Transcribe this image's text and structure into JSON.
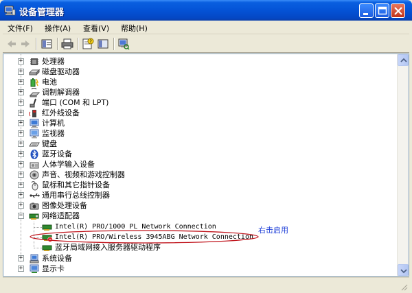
{
  "window": {
    "title": "设备管理器"
  },
  "menu": [
    {
      "label": "文件(F)"
    },
    {
      "label": "操作(A)"
    },
    {
      "label": "查看(V)"
    },
    {
      "label": "帮助(H)"
    }
  ],
  "toolbar": {
    "buttons": [
      {
        "icon": "back-arrow-icon"
      },
      {
        "icon": "forward-arrow-icon"
      },
      {
        "icon": "properties-pane-icon"
      },
      {
        "icon": "printer-icon"
      },
      {
        "icon": "help-properties-icon"
      },
      {
        "icon": "view-toggle-icon"
      },
      {
        "icon": "scan-hardware-icon"
      }
    ]
  },
  "tree": {
    "categories": [
      {
        "label": "处理器",
        "icon": "processor-icon",
        "expanded": false
      },
      {
        "label": "磁盘驱动器",
        "icon": "disk-drive-icon",
        "expanded": false
      },
      {
        "label": "电池",
        "icon": "battery-icon",
        "expanded": false
      },
      {
        "label": "调制解调器",
        "icon": "modem-icon",
        "expanded": false
      },
      {
        "label": "端口 (COM 和 LPT)",
        "icon": "port-icon",
        "expanded": false
      },
      {
        "label": "红外线设备",
        "icon": "infrared-icon",
        "expanded": false
      },
      {
        "label": "计算机",
        "icon": "computer-icon",
        "expanded": false
      },
      {
        "label": "监视器",
        "icon": "monitor-icon",
        "expanded": false
      },
      {
        "label": "键盘",
        "icon": "keyboard-icon",
        "expanded": false
      },
      {
        "label": "蓝牙设备",
        "icon": "bluetooth-icon",
        "expanded": false
      },
      {
        "label": "人体学输入设备",
        "icon": "hid-icon",
        "expanded": false
      },
      {
        "label": "声音、视频和游戏控制器",
        "icon": "sound-icon",
        "expanded": false
      },
      {
        "label": "鼠标和其它指针设备",
        "icon": "mouse-icon",
        "expanded": false
      },
      {
        "label": "通用串行总线控制器",
        "icon": "usb-icon",
        "expanded": false
      },
      {
        "label": "图像处理设备",
        "icon": "imaging-icon",
        "expanded": false
      },
      {
        "label": "网络适配器",
        "icon": "network-adapter-icon",
        "expanded": true
      },
      {
        "label": "系统设备",
        "icon": "system-device-icon",
        "expanded": false
      },
      {
        "label": "显示卡",
        "icon": "display-adapter-icon",
        "expanded": false
      }
    ],
    "network_children": [
      {
        "label": "Intel(R) PRO/1000 PL Network Connection",
        "icon": "nic-icon",
        "disabled": false
      },
      {
        "label": "Intel(R) PRO/Wireless 3945ABG Network Connection",
        "icon": "nic-disabled-icon",
        "disabled": true
      },
      {
        "label": "蓝牙局域网接入服务器驱动程序",
        "icon": "nic-icon",
        "disabled": false
      }
    ]
  },
  "annotation": {
    "text": "右击启用",
    "color": "#1e3fd8",
    "ellipse_color": "#c0141c"
  }
}
